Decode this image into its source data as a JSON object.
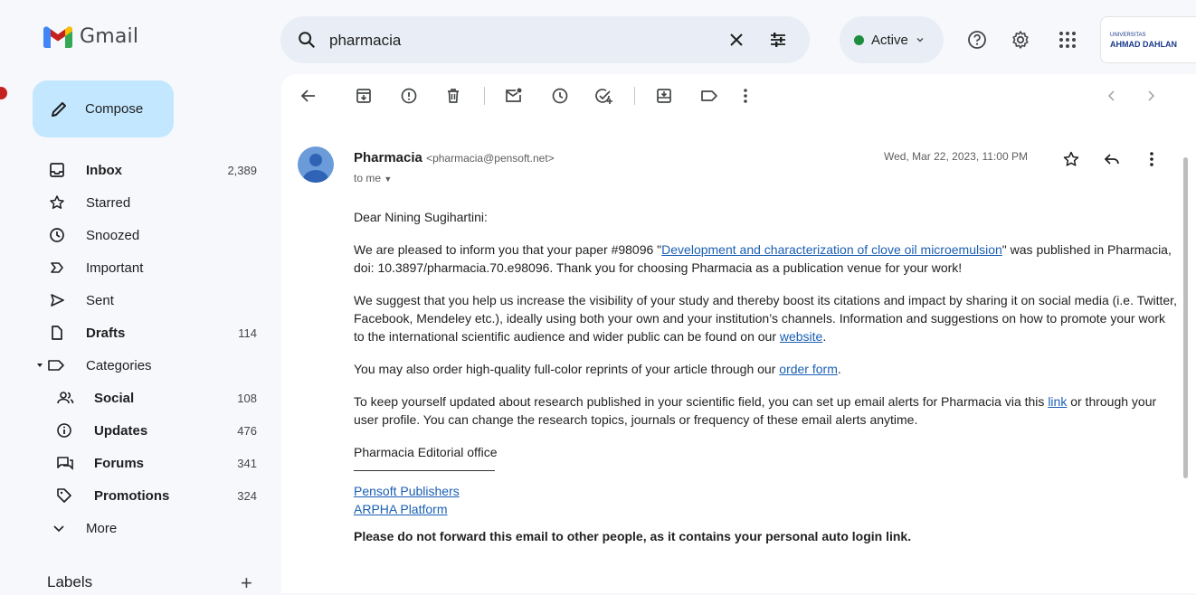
{
  "app": {
    "name": "Gmail"
  },
  "search": {
    "value": "pharmacia"
  },
  "status": {
    "label": "Active"
  },
  "org": {
    "line1": "UNIVERSITAS",
    "line2": "AHMAD DAHLAN"
  },
  "compose": {
    "label": "Compose"
  },
  "nav": {
    "inbox": {
      "label": "Inbox",
      "count": "2,389"
    },
    "starred": {
      "label": "Starred"
    },
    "snoozed": {
      "label": "Snoozed"
    },
    "important": {
      "label": "Important"
    },
    "sent": {
      "label": "Sent"
    },
    "drafts": {
      "label": "Drafts",
      "count": "114"
    },
    "categories": {
      "label": "Categories"
    },
    "social": {
      "label": "Social",
      "count": "108"
    },
    "updates": {
      "label": "Updates",
      "count": "476"
    },
    "forums": {
      "label": "Forums",
      "count": "341"
    },
    "promotions": {
      "label": "Promotions",
      "count": "324"
    },
    "more": {
      "label": "More"
    }
  },
  "labels": {
    "title": "Labels",
    "add": "+"
  },
  "email": {
    "sender_name": "Pharmacia",
    "sender_email": "<pharmacia@pensoft.net>",
    "to": "to me",
    "date": "Wed, Mar 22, 2023, 11:00 PM",
    "greeting": "Dear Nining Sugihartini:",
    "p1_a": "We are pleased to inform you that your paper #98096 \"",
    "p1_link": "Development and characterization of clove oil microemulsion",
    "p1_b": "\" was published in Pharmacia, doi: 10.3897/pharmacia.70.e98096. Thank you for choosing Pharmacia as a publication venue for your work!",
    "p2_a": "We suggest that you help us increase the visibility of your study and thereby boost its citations and impact by sharing it on social media (i.e. Twitter, Facebook, Mendeley etc.), ideally using both your own and your institution’s channels. Information and suggestions on how to promote your work to the international scientific audience and wider public can be found on our ",
    "p2_link": "website",
    "p2_b": ".",
    "p3_a": "You may also order high-quality full-color reprints of your article through our ",
    "p3_link": "order form",
    "p3_b": ".",
    "p4_a": "To keep yourself updated about research published in your scientific field, you can set up email alerts for Pharmacia via this ",
    "p4_link": "link",
    "p4_b": " or through your user profile. You can change the research topics, journals or frequency of these email alerts anytime.",
    "signoff": "Pharmacia Editorial office",
    "link1": "Pensoft Publishers",
    "link2": "ARPHA Platform",
    "warning": "Please do not forward this email to other people, as it contains your personal auto login link."
  },
  "colors": {
    "accent": "#c2e7ff",
    "link": "#1a5fb4",
    "active_dot": "#1e8e3e"
  }
}
